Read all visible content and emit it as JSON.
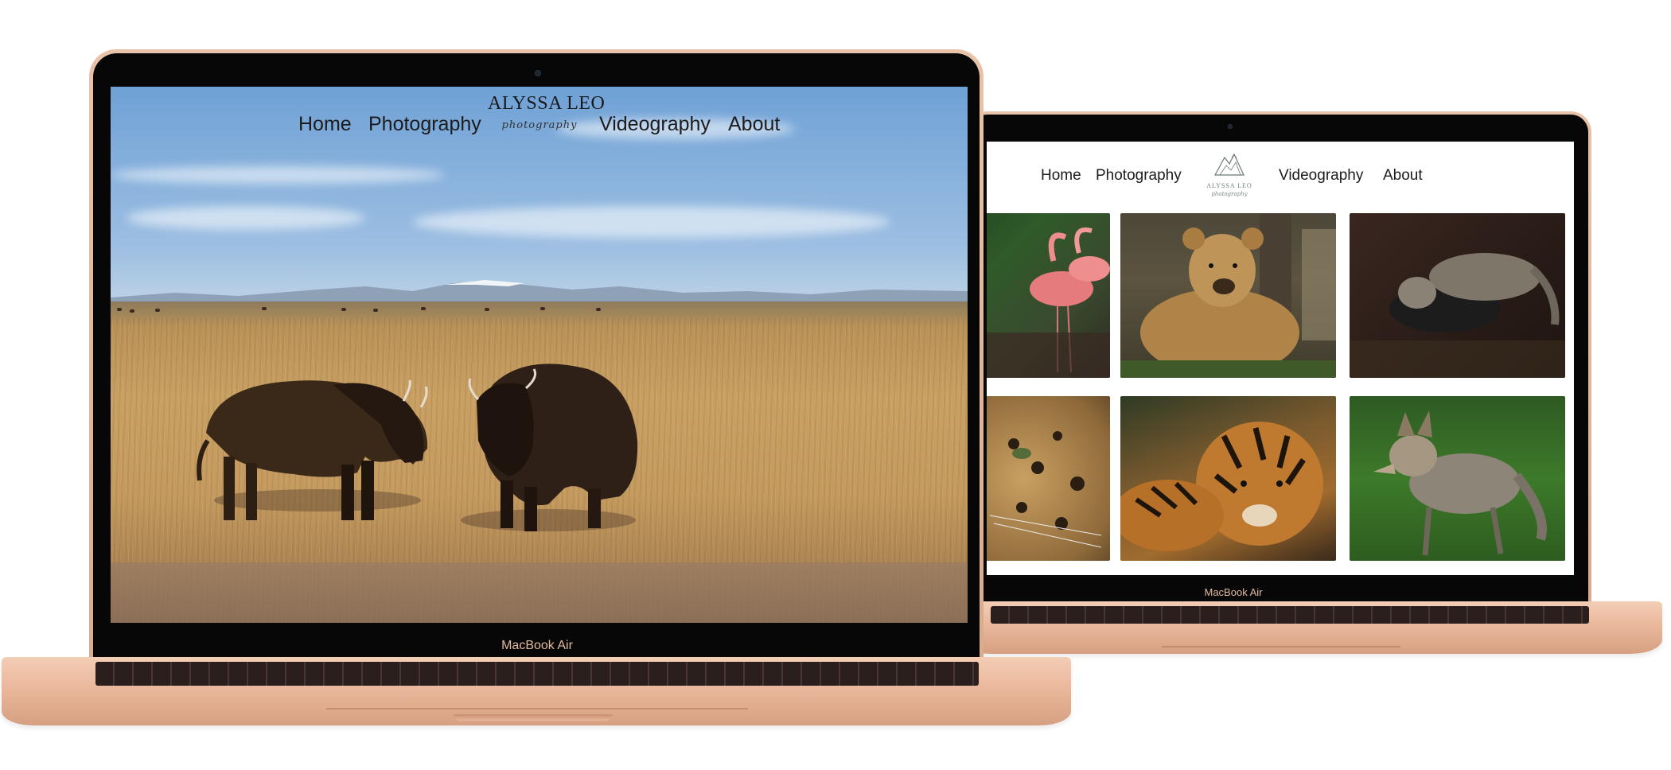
{
  "devices": {
    "large_laptop_label": "MacBook Air",
    "small_laptop_label": "MacBook Air"
  },
  "hero_site": {
    "nav": {
      "home": "Home",
      "photography": "Photography",
      "videography": "Videography",
      "about": "About"
    },
    "logo": {
      "name": "ALYSSA LEO",
      "script": "photography"
    },
    "hero_image": "bison-on-prairie-photo"
  },
  "gallery_site": {
    "nav": {
      "home": "Home",
      "photography": "Photography",
      "videography": "Videography",
      "about": "About"
    },
    "logo": {
      "name": "ALYSSA LEO",
      "script": "photography"
    },
    "gallery": [
      {
        "subject": "flamingos"
      },
      {
        "subject": "grizzly-bear"
      },
      {
        "subject": "fishing-cat"
      },
      {
        "subject": "jaguar"
      },
      {
        "subject": "tiger"
      },
      {
        "subject": "coyote"
      }
    ]
  },
  "colors": {
    "laptop_gold": "#e6b99c",
    "bezel": "#070707"
  }
}
